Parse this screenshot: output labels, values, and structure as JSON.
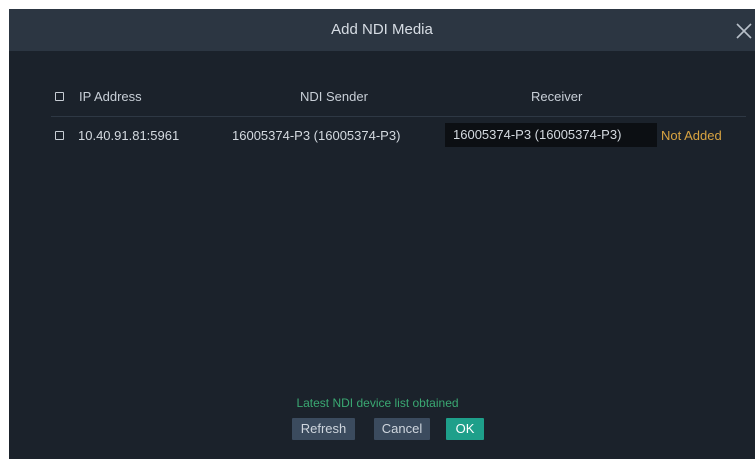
{
  "dialog": {
    "title": "Add NDI Media",
    "close_icon": "close-icon"
  },
  "table": {
    "headers": {
      "ip": "IP Address",
      "sender": "NDI Sender",
      "receiver": "Receiver"
    },
    "rows": [
      {
        "ip": "10.40.91.81:5961",
        "sender": "16005374-P3 (16005374-P3)",
        "receiver": "16005374-P3 (16005374-P3)",
        "status": "Not Added"
      }
    ]
  },
  "footer": {
    "message": "Latest NDI device list obtained",
    "refresh_label": "Refresh",
    "cancel_label": "Cancel",
    "ok_label": "OK"
  },
  "colors": {
    "background": "#1b222b",
    "titlebar": "#2c3642",
    "status_not_added": "#d9a441",
    "message_success": "#3aa872",
    "ok_button": "#1e9f8a"
  }
}
